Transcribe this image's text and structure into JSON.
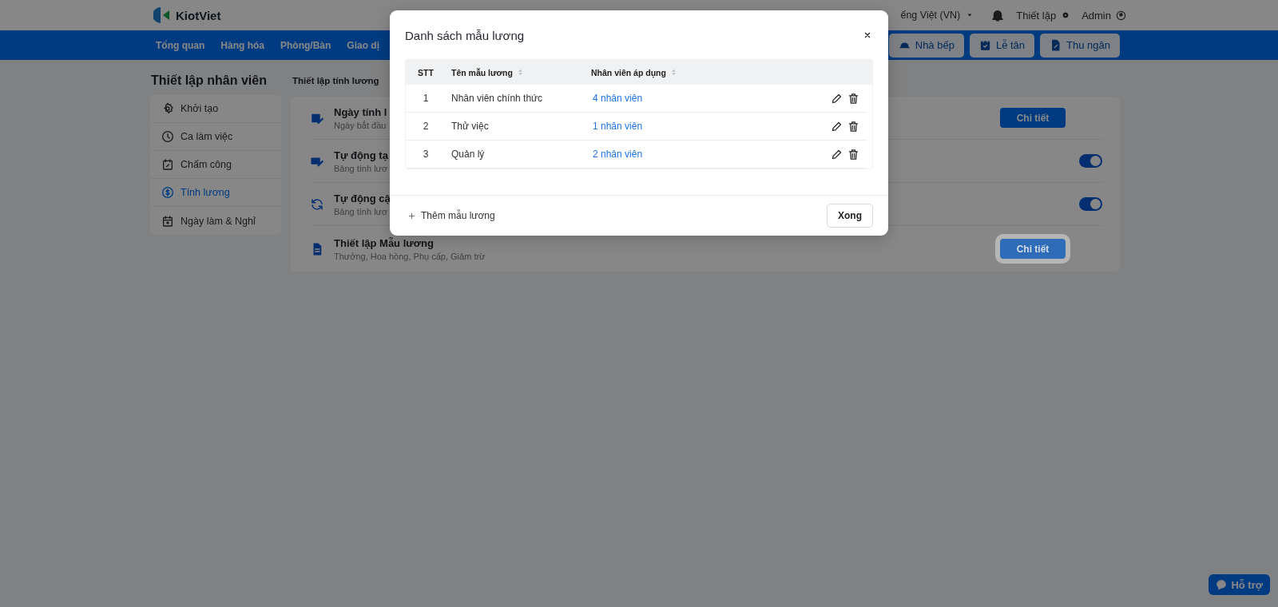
{
  "header": {
    "logo": "KiotViet",
    "language": "ếng Việt (VN)",
    "settings": "Thiết lập",
    "user": "Admin"
  },
  "nav": {
    "items": [
      {
        "label": "Tổng quan"
      },
      {
        "label": "Hàng hóa"
      },
      {
        "label": "Phòng/Bàn"
      },
      {
        "label": "Giao dị"
      }
    ],
    "actions": [
      {
        "label": "Nhà bếp"
      },
      {
        "label": "Lễ tân"
      },
      {
        "label": "Thu ngân"
      }
    ]
  },
  "sidebar": {
    "title": "Thiết lập nhân viên",
    "items": [
      {
        "label": "Khởi tạo",
        "selected": false
      },
      {
        "label": "Ca làm việc",
        "selected": false
      },
      {
        "label": "Chấm công",
        "selected": false
      },
      {
        "label": "Tính lương",
        "selected": true
      },
      {
        "label": "Ngày làm & Nghỉ",
        "selected": false
      }
    ]
  },
  "main": {
    "title": "Thiết lập tính lương",
    "settings": [
      {
        "kind": "button",
        "title": "Ngày tính l",
        "description": "Ngày bắt đầu",
        "button": "Chi tiết",
        "highlighted": false
      },
      {
        "kind": "toggle",
        "title": "Tự động tạ",
        "description": "Bảng tính lươ",
        "on": true
      },
      {
        "kind": "toggle",
        "title": "Tự động cậ",
        "description": "Bảng tính lươ",
        "on": true
      },
      {
        "kind": "button",
        "title": "Thiết lập Mẫu lương",
        "description": "Thưởng, Hoa hồng, Phụ cấp, Giảm trừ",
        "button": "Chi tiết",
        "highlighted": true
      }
    ]
  },
  "modal": {
    "title": "Danh sách mẫu lương",
    "columns": [
      {
        "label": "STT",
        "sortable": false
      },
      {
        "label": "Tên mẫu lương",
        "sortable": true
      },
      {
        "label": "Nhân viên áp dụng",
        "sortable": true
      }
    ],
    "rows": [
      {
        "index": "1",
        "name": "Nhân viên chính thức",
        "employees": "4 nhân viên"
      },
      {
        "index": "2",
        "name": "Thử việc",
        "employees": "1 nhân viên"
      },
      {
        "index": "3",
        "name": "Quản lý",
        "employees": "2 nhân viên"
      }
    ],
    "add": "Thêm mẫu lương",
    "done": "Xong"
  },
  "help": "Hỗ trợ"
}
